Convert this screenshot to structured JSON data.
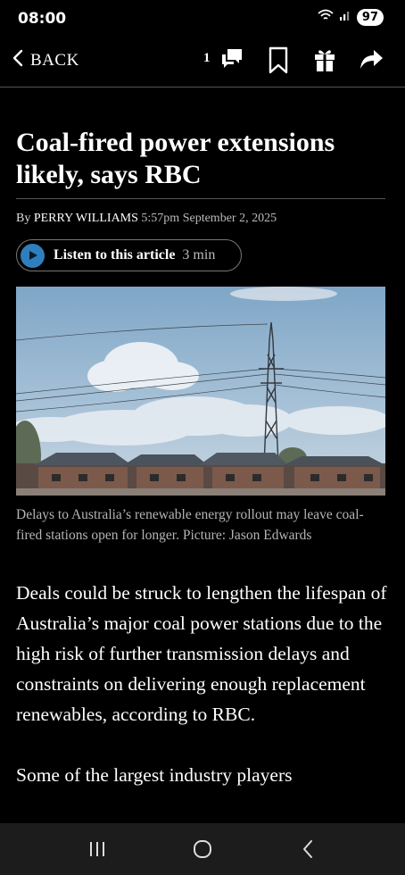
{
  "status_bar": {
    "time": "08:00",
    "battery": "97",
    "icons": [
      "wifi-icon",
      "signal-icon",
      "battery-icon"
    ]
  },
  "header": {
    "back_label": "BACK",
    "comment_count": "1",
    "icons": [
      "chevron-left-icon",
      "comments-icon",
      "bookmark-icon",
      "gift-icon",
      "share-icon"
    ]
  },
  "article": {
    "headline": "Coal-fired power extensions likely, says RBC",
    "byline_prefix": "By",
    "author": "PERRY WILLIAMS",
    "timestamp": "5:57pm September 2, 2025",
    "listen": {
      "label": "Listen to this article",
      "duration": "3 min"
    },
    "image_caption": "Delays to Australia’s renewable energy rollout may leave coal-fired stations open for longer. Picture: Jason Edwards",
    "paragraphs": [
      "Deals could be struck to lengthen the lifespan of Australia’s major coal power stations due to the high risk of further transmission delays and constraints on delivering enough replacement renewables, according to RBC.",
      "Some of the largest industry players"
    ]
  },
  "nav_bar": {
    "icons": [
      "recent-apps-icon",
      "home-icon",
      "back-nav-icon"
    ]
  },
  "colors": {
    "background": "#000000",
    "play_button": "#2f7fbf",
    "nav_bar": "#1c1c1c"
  }
}
